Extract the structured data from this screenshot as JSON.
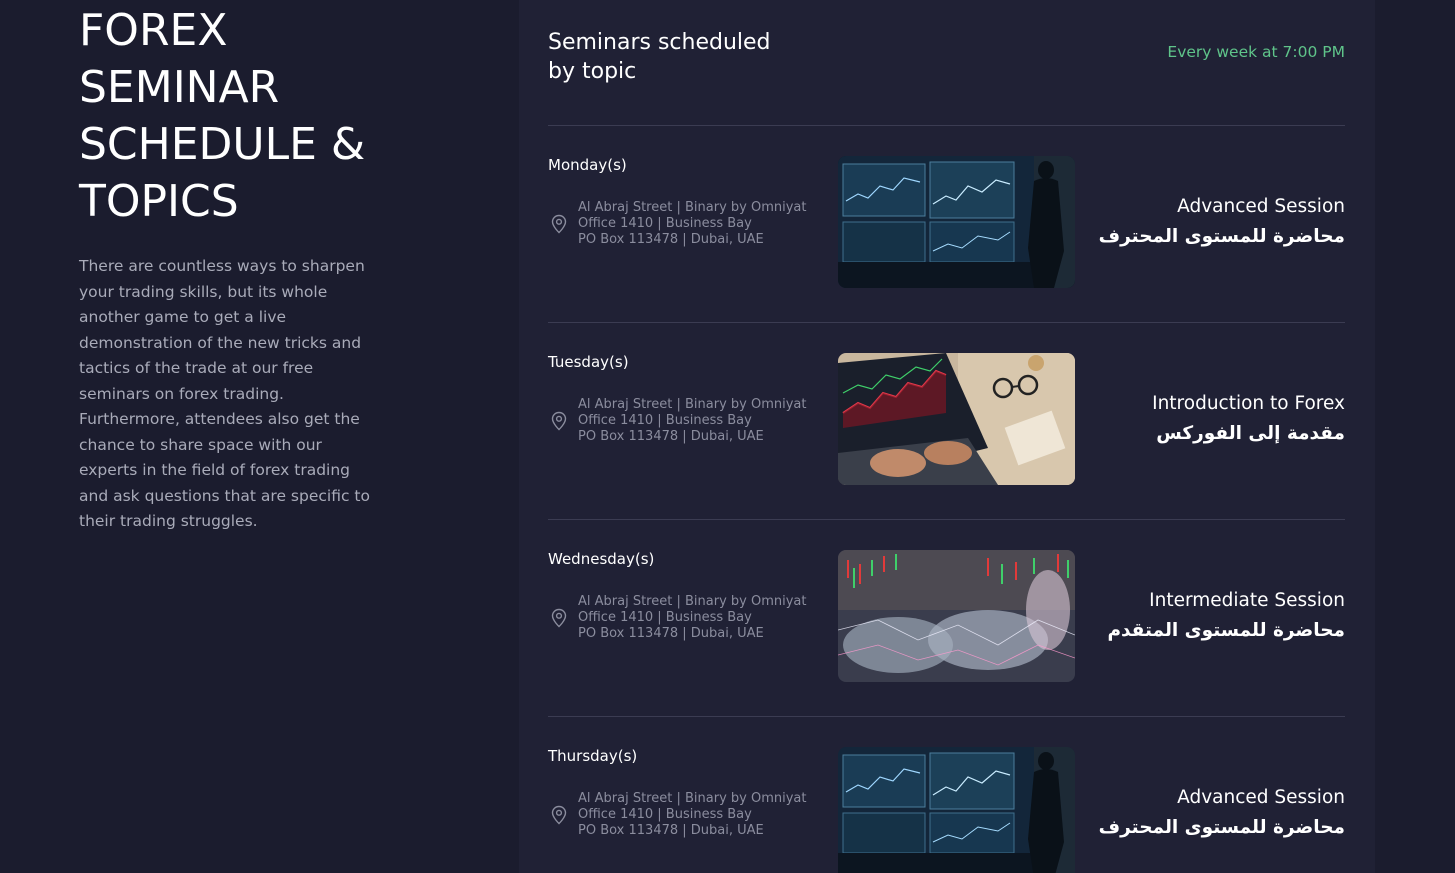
{
  "left": {
    "title_lines": [
      "FOREX",
      "SEMINAR",
      "SCHEDULE &",
      "TOPICS"
    ],
    "intro": "There are countless ways to sharpen your trading skills, but its whole another game to get a live demonstration of the new tricks and tactics of the trade at our free seminars on forex trading. Furthermore, attendees also get the chance to share space with our experts in the field of forex trading and ask questions that are specific to their trading struggles."
  },
  "schedule": {
    "title_lines": [
      "Seminars scheduled",
      "by topic"
    ],
    "frequency": "Every week at 7:00 PM",
    "accent_color": "#5fc48a",
    "rows": [
      {
        "day": "Monday(s)",
        "address": [
          "Al Abraj Street | Binary by Omniyat",
          "Office 1410 | Business Bay",
          "PO Box 113478 | Dubai, UAE"
        ],
        "topic_en": "Advanced Session",
        "topic_ar": "محاضرة للمستوى المحترف",
        "image": "trader-monitors-city"
      },
      {
        "day": "Tuesday(s)",
        "address": [
          "Al Abraj Street | Binary by Omniyat",
          "Office 1410 | Business Bay",
          "PO Box 113478 | Dubai, UAE"
        ],
        "topic_en": "Introduction to Forex",
        "topic_ar": "مقدمة إلى الفوركس",
        "image": "laptop-chart-desk"
      },
      {
        "day": "Wednesday(s)",
        "address": [
          "Al Abraj Street | Binary by Omniyat",
          "Office 1410 | Business Bay",
          "PO Box 113478 | Dubai, UAE"
        ],
        "topic_en": "Intermediate Session",
        "topic_ar": "محاضرة للمستوى المتقدم",
        "image": "seminar-audience-chart-overlay"
      },
      {
        "day": "Thursday(s)",
        "address": [
          "Al Abraj Street | Binary by Omniyat",
          "Office 1410 | Business Bay",
          "PO Box 113478 | Dubai, UAE"
        ],
        "topic_en": "Advanced Session",
        "topic_ar": "محاضرة للمستوى المحترف",
        "image": "trader-monitors-city"
      }
    ]
  }
}
